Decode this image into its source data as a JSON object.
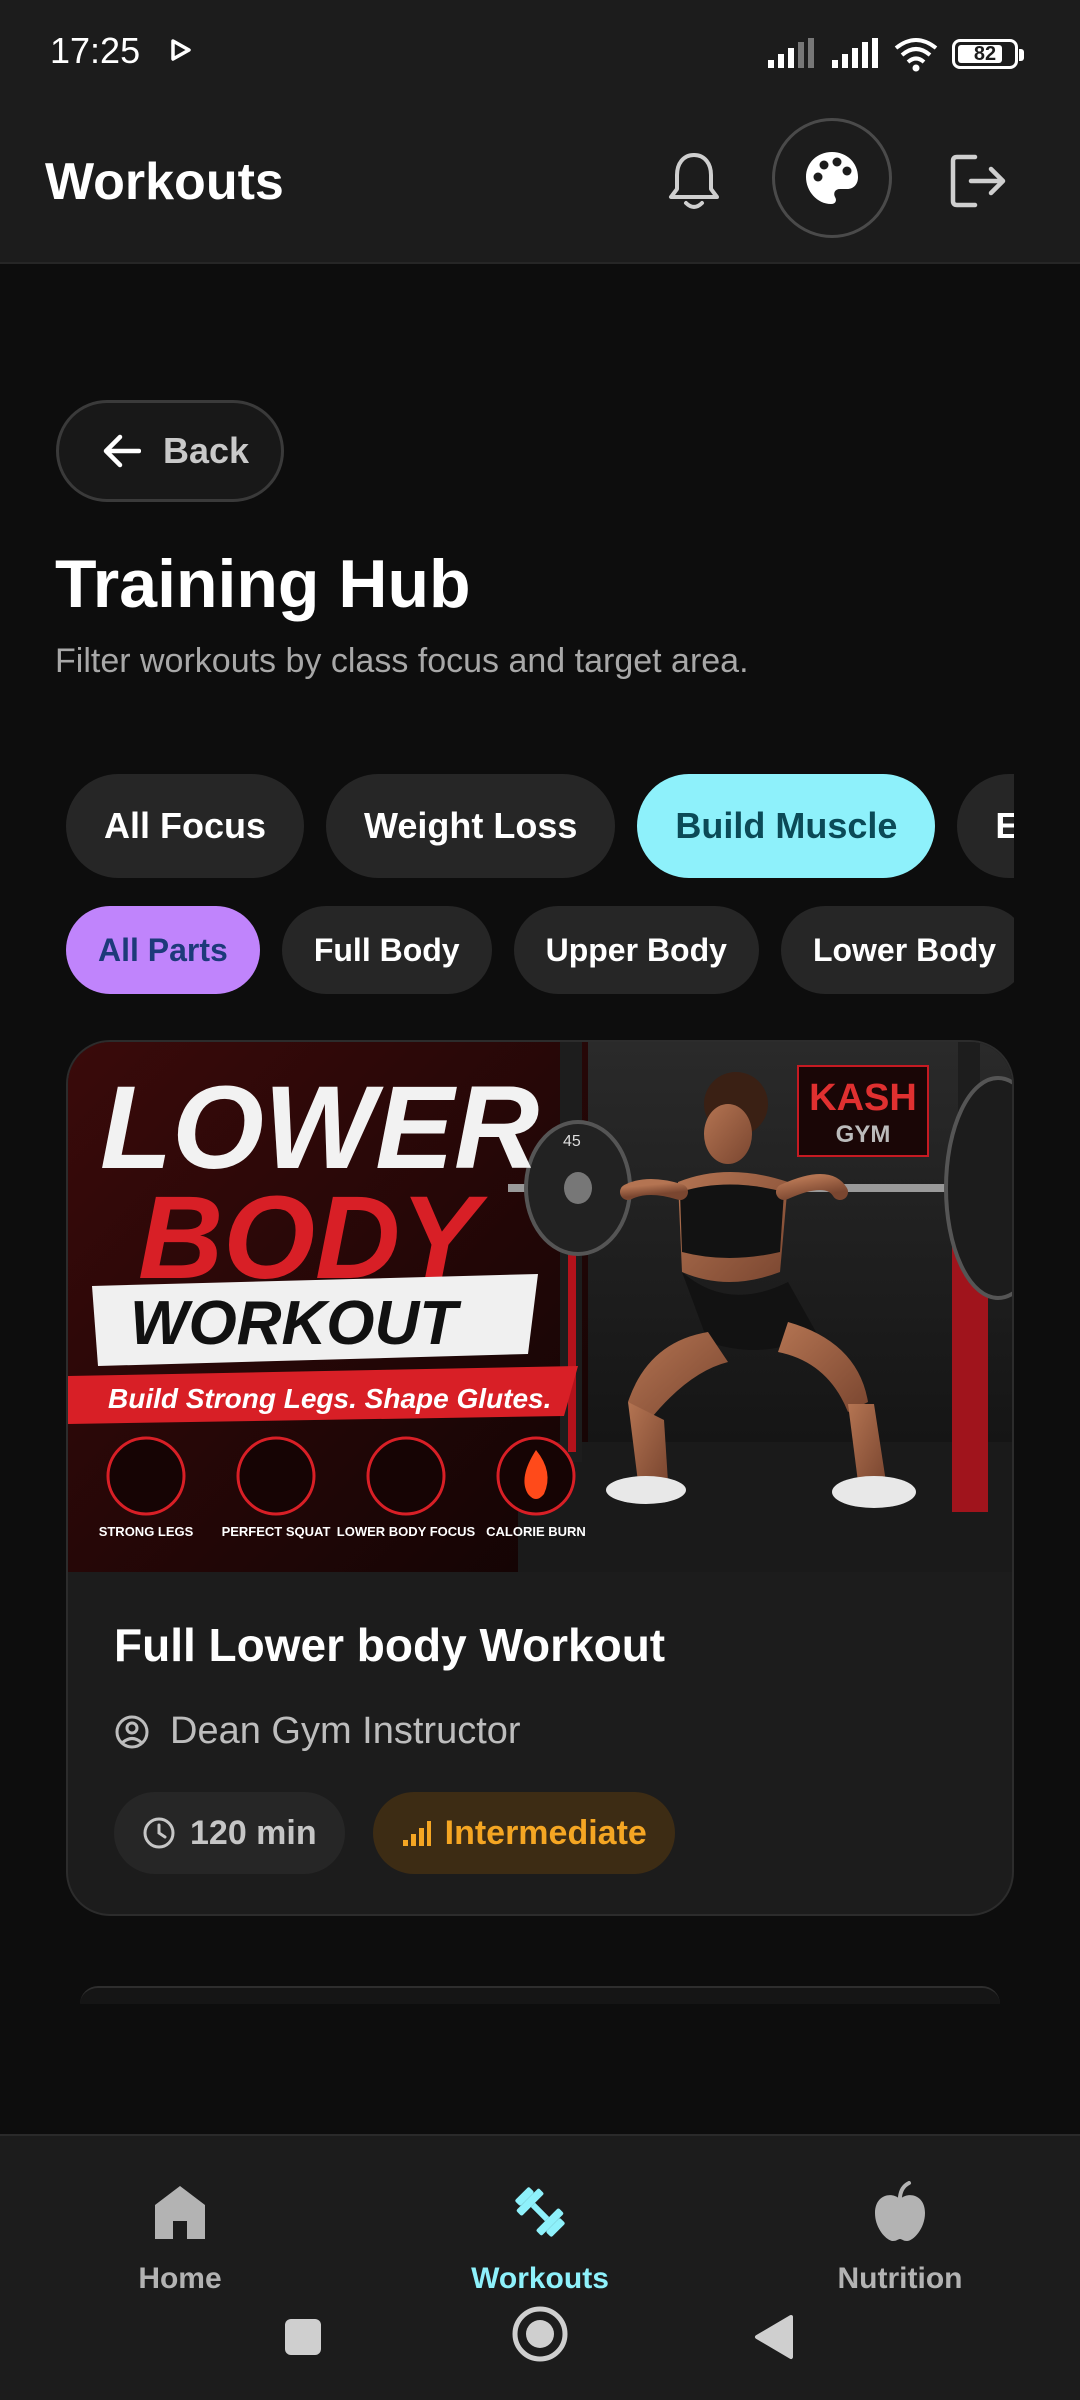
{
  "status_bar": {
    "time": "17:25",
    "battery": "82",
    "battery_level": 0.82
  },
  "header": {
    "title": "Workouts",
    "icons": [
      "bell-icon",
      "palette-icon",
      "logout-icon"
    ]
  },
  "back_button": {
    "label": "Back"
  },
  "page": {
    "title": "Training Hub",
    "subtitle": "Filter workouts by class focus and target area."
  },
  "focus_filters": [
    {
      "label": "All Focus",
      "active": false
    },
    {
      "label": "Weight Loss",
      "active": false
    },
    {
      "label": "Build Muscle",
      "active": true
    },
    {
      "label": "Endurance",
      "active": false
    }
  ],
  "part_filters": [
    {
      "label": "All Parts",
      "active": true
    },
    {
      "label": "Full Body",
      "active": false
    },
    {
      "label": "Upper Body",
      "active": false
    },
    {
      "label": "Lower Body",
      "active": false
    }
  ],
  "workout_card": {
    "image": {
      "headline_1": "LOWER",
      "headline_2": "BODY",
      "headline_3": "WORKOUT",
      "tagline": "Build Strong Legs. Shape Glutes.",
      "badges": [
        "STRONG LEGS",
        "PERFECT SQUAT",
        "LOWER BODY FOCUS",
        "CALORIE BURN"
      ],
      "gym_sign_1": "KASH",
      "gym_sign_2": "GYM",
      "plate_label": "45"
    },
    "title": "Full Lower body Workout",
    "instructor": "Dean Gym Instructor",
    "duration": "120 min",
    "level": "Intermediate"
  },
  "bottom_nav": {
    "items": [
      {
        "label": "Home",
        "icon": "home-icon"
      },
      {
        "label": "Workouts",
        "icon": "dumbbell-icon",
        "active": true
      },
      {
        "label": "Nutrition",
        "icon": "apple-icon"
      }
    ]
  },
  "colors": {
    "accent_cyan": "#8ef1fb",
    "accent_purple": "#c084fc",
    "level_orange": "#f5a623",
    "background": "#0d0d0d",
    "surface": "#1c1c1c"
  }
}
